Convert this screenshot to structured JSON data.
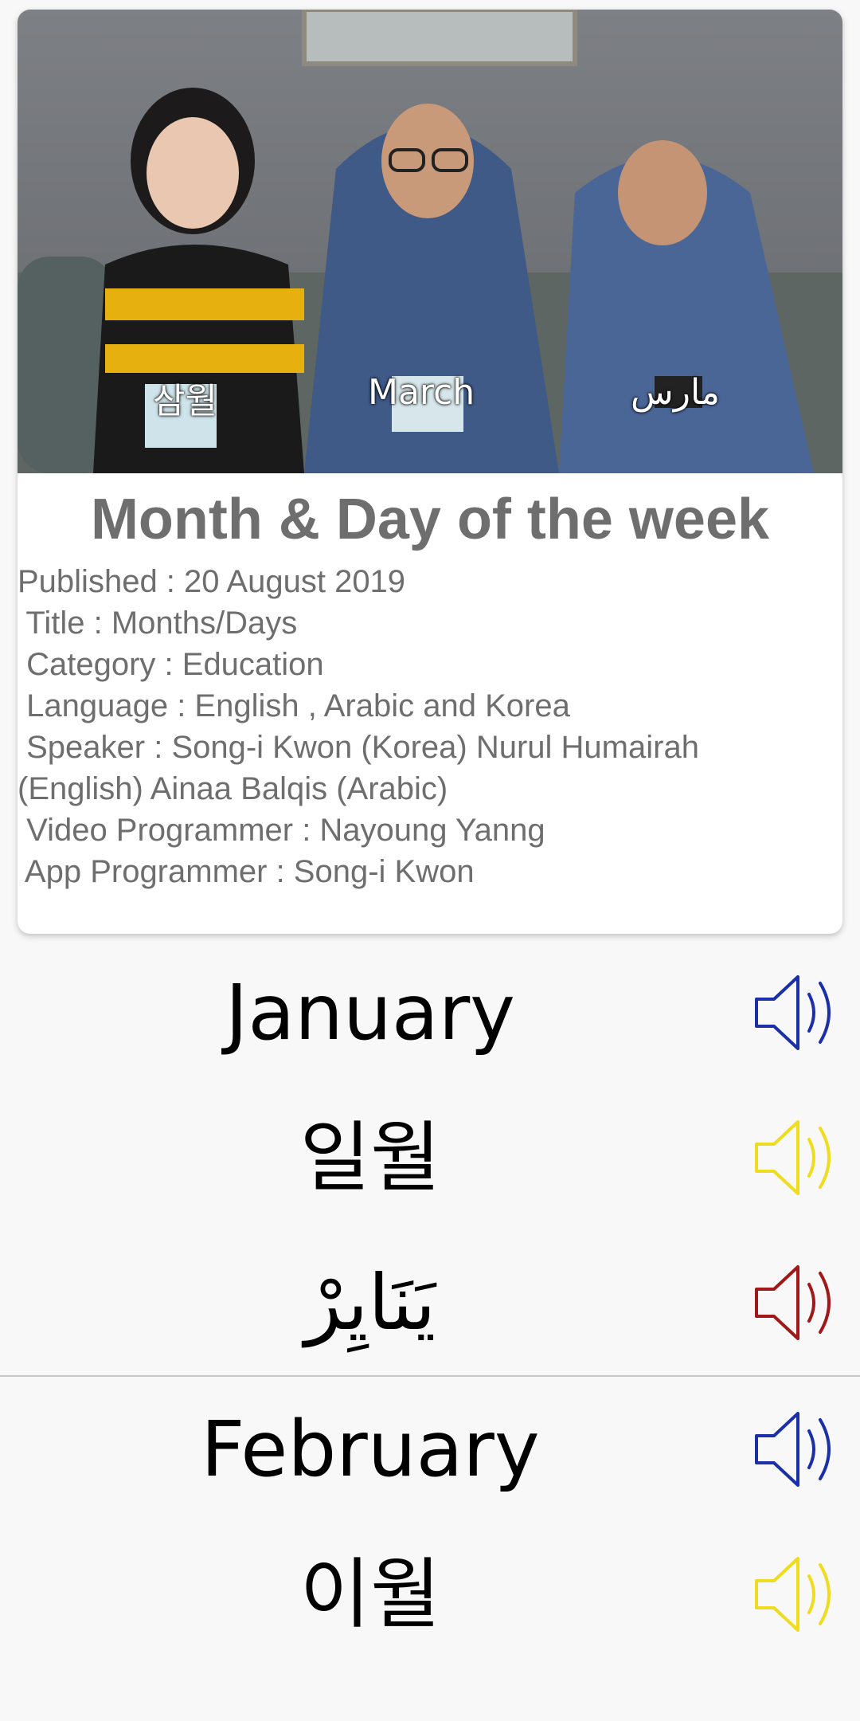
{
  "video": {
    "subtitles": [
      "삼월",
      "March",
      "مارس"
    ]
  },
  "card": {
    "title": "Month & Day of the week",
    "info": [
      "Published : 20 August 2019",
      " Title : Months/Days",
      " Category : Education",
      " Language : English , Arabic and Korea",
      " Speaker : Song-i Kwon (Korea) Nurul Humairah",
      "(English) Ainaa Balqis (Arabic)",
      " Video Programmer : Nayoung Yanng",
      " App Programmer : Song-i Kwon"
    ]
  },
  "months": [
    {
      "english": "January",
      "korean": "일월",
      "arabic": "يَنَايِرْ"
    },
    {
      "english": "February",
      "korean": "이월"
    }
  ],
  "colors": {
    "english_speaker": "#1a2fa8",
    "korean_speaker": "#f0dc1e",
    "arabic_speaker": "#a01818",
    "info_text": "#6e6e6e"
  },
  "icons": {
    "speaker": "speaker-icon"
  }
}
